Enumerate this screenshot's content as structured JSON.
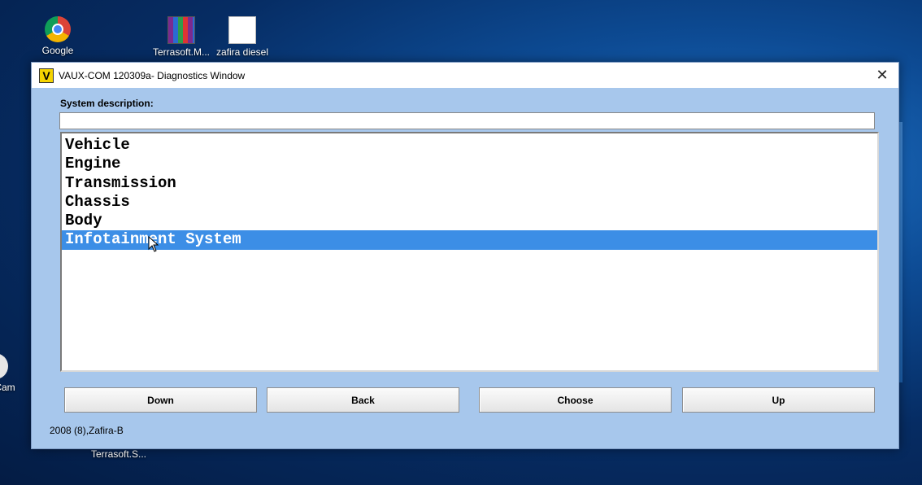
{
  "desktop": {
    "icons": [
      {
        "label": "Google",
        "icon": "chrome-icon"
      },
      {
        "label": "Terrasoft.M...",
        "icon": "winrar-icon"
      },
      {
        "label": "zafira diesel",
        "icon": "file-icon"
      },
      {
        "label": "Cam",
        "icon": "camera-icon"
      },
      {
        "label": "Terrasoft.S...",
        "icon": "app-icon"
      }
    ]
  },
  "window": {
    "app_logo": "V",
    "title": "VAUX-COM 120309a- Diagnostics Window",
    "close_glyph": "✕"
  },
  "system_description": {
    "label": "System description:",
    "value": ""
  },
  "systems_list": {
    "items": [
      "Vehicle",
      "Engine",
      "Transmission",
      "Chassis",
      "Body",
      "Infotainment System"
    ],
    "selected": "Infotainment System"
  },
  "buttons": {
    "down": "Down",
    "back": "Back",
    "choose": "Choose",
    "up": "Up"
  },
  "status": {
    "vehicle_info": "2008 (8),Zafira-B"
  },
  "colors": {
    "window_bg": "#a7c7ec",
    "selection": "#3c8ee6",
    "app_logo_bg": "#f5d400"
  }
}
